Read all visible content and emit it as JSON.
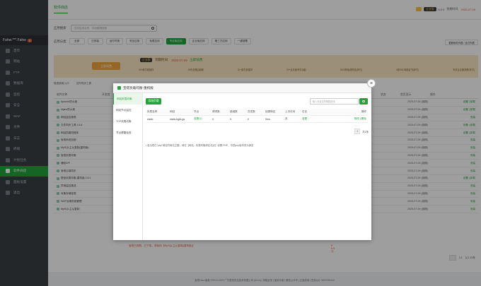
{
  "sidebar": {
    "user": "Fahw.***.Fahw",
    "badge": "0",
    "items": [
      {
        "label": "首页",
        "icon": "home-icon"
      },
      {
        "label": "网站",
        "icon": "globe-icon"
      },
      {
        "label": "FTP",
        "icon": "ftp-icon"
      },
      {
        "label": "数据库",
        "icon": "database-icon"
      },
      {
        "label": "监控",
        "icon": "monitor-icon"
      },
      {
        "label": "安全",
        "icon": "shield-icon"
      },
      {
        "label": "WAF",
        "icon": "firewall-icon"
      },
      {
        "label": "文件",
        "icon": "folder-icon"
      },
      {
        "label": "日志",
        "icon": "log-icon"
      },
      {
        "label": "终端",
        "icon": "terminal-icon"
      },
      {
        "label": "计划任务",
        "icon": "clock-icon"
      },
      {
        "label": "软件商店",
        "icon": "store-icon",
        "active": true
      },
      {
        "label": "面板设置",
        "icon": "gear-icon"
      },
      {
        "label": "退出",
        "icon": "logout-icon"
      }
    ]
  },
  "topbar": {
    "title": "软件商店",
    "vip": "企业版",
    "version": "8.0.0",
    "expire_label": "到期时间:",
    "expire_date": "2025-07-09",
    "renew": "续费"
  },
  "main": {
    "search_label": "应用搜索",
    "search_placeholder": "支持应用名称、字段模糊搜索",
    "cat_label": "应用分类",
    "categories": [
      {
        "label": "全部"
      },
      {
        "label": "已安装"
      },
      {
        "label": "运行环境"
      },
      {
        "label": "安全应用"
      },
      {
        "label": "免费应用"
      },
      {
        "label": "专业版应用",
        "active": true
      },
      {
        "label": "企业版应用"
      },
      {
        "label": "第三方应用"
      },
      {
        "label": "一键部署"
      }
    ],
    "update_btn": "更新软件列表 / 支付列表",
    "promo": {
      "buy": "立即续费",
      "vip": "企业版",
      "expire_label": "到期时间:",
      "expire_date": "2025-07-09",
      "renew": "立即续费",
      "features": [
        "30+款付费插件",
        "15天无理由退款",
        "20+款付费插件",
        "20+企业版专享功能",
        "1000条免费短信(年付)",
        "2张SSL商用证书(年付)",
        "专享企业服务群(年付)"
      ]
    },
    "options": [
      "描述使用入口",
      "文件同步工具"
    ],
    "table_head": [
      "软件名称",
      "开发商",
      "说明",
      "价格",
      "到期时间",
      "位置",
      "状态",
      "首页显示",
      "操作"
    ],
    "rows": [
      {
        "name": "Apache防火墙",
        "date": "2025-07-09 (续期)",
        "act": "设置 | 卸载"
      },
      {
        "name": "Nginx防火墙",
        "date": "2025-07-09 (续期)",
        "act": "设置 | 卸载"
      },
      {
        "name": "网站监控报表",
        "date": "2025-07-09 (续期)",
        "act": "安装"
      },
      {
        "name": "文件同步工具 1.6.4",
        "date": "2025-07-09 (续期)",
        "act": "设置 | 卸载"
      },
      {
        "name": "网站防篡改程序",
        "date": "2025-07-09 (续期)",
        "act": "设置 | 卸载"
      },
      {
        "name": "宝塔系统加固",
        "date": "2025-07-09 (续期)",
        "act": "安装"
      },
      {
        "name": "MySQL主从复制(重构版)",
        "date": "2025-07-09 (续期)",
        "act": "安装"
      },
      {
        "name": "宝塔负载均衡",
        "date": "2025-07-09 (续期)",
        "act": "安装"
      },
      {
        "name": "通知API",
        "date": "2025-07-09 (续期)",
        "act": "安装"
      },
      {
        "name": "宝塔云端同步",
        "date": "2025-07-09 (续期)",
        "act": "安装"
      },
      {
        "name": "堡垒负载均衡-重构版 2.6.1",
        "date": "2025-07-09 (续期)",
        "act": "设置 | 卸载"
      },
      {
        "name": "异常监控推送",
        "date": "2025-07-09 (续期)",
        "act": "安装"
      },
      {
        "name": "对象存储挂载",
        "date": "2025-07-09 (续期)",
        "act": "安装"
      },
      {
        "name": "WAF远端安装管理",
        "date": "2025-07-09 (续期)",
        "act": "安装"
      },
      {
        "name": "MySQL主从复制",
        "date": "2025-07-09 (续期)",
        "act": "安装"
      }
    ],
    "tail_warn": "宝塔已到期，已下架，请使用【MySQL主从复制(重构版)】",
    "tail_price": "¥ 9.9元",
    "pager_text": "1/1",
    "pager_total": "从1-15条"
  },
  "footer": "宝塔Linux面板 ©2014-2023 广东堡塔安全技术有限公司 (bt.cn)  |  求助反馈  |  使用手册  |  微信公众号  |  正版查询  |  售前QQ: 3007255432",
  "modal": {
    "title": "宝塔负载均衡-重构版",
    "close": "×",
    "side": [
      {
        "label": "网站负载均衡",
        "active": true
      },
      {
        "label": "网站节点监控"
      },
      {
        "label": "TCP负载均衡"
      },
      {
        "label": "节点健康检查"
      }
    ],
    "add_btn": "添加负载",
    "search_placeholder": "输入负载名称模糊查询",
    "columns": [
      "负载名称",
      "网站",
      "节点",
      "请求数",
      "错误数",
      "并发数",
      "回源响应",
      "上次访问",
      "日志",
      "操作"
    ],
    "row": {
      "name": "static",
      "site": "static.bght.gs",
      "nodes": "查看(1)",
      "req": "0",
      "err": "0",
      "conn": "0",
      "resp": "0ms",
      "last": "无",
      "log": "查看",
      "ops": "修改 | 删除"
    },
    "pager_page": "1",
    "pager_total": "共1条",
    "tip": "• 若出现已\"php\"域名的网站主题，请在【网站 - 负载均衡绑定站点】设置-PHP，中把php版本改为静态"
  }
}
